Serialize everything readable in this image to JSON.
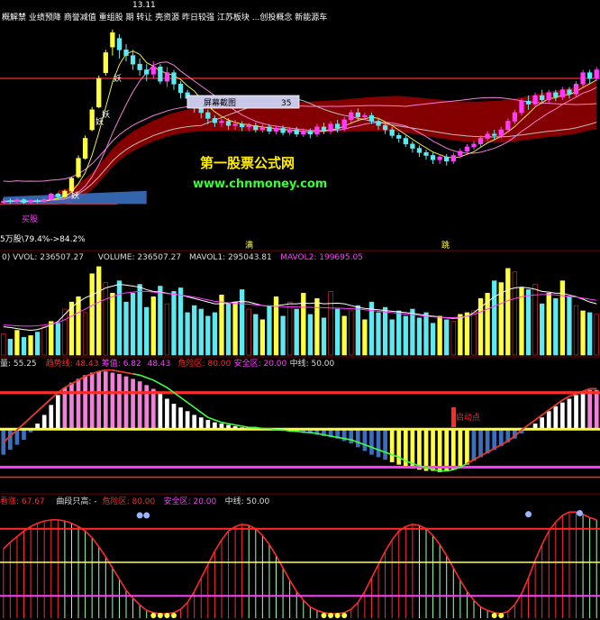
{
  "colors": {
    "bg": "#000000",
    "separator": "#7a0000",
    "red": "#ff2a2a",
    "cyan": "#5ee8f0",
    "magenta": "#ff3cff",
    "yellow": "#ffff40",
    "white": "#ffffff",
    "blue": "#3a6fbf",
    "pink": "#f080d8",
    "green": "#40ff40",
    "gray": "#bdbdbd",
    "darkred": "#8b0000",
    "watermark_yellow": "#ffee00",
    "watermark_green": "#33ff33"
  },
  "price_panel": {
    "top_labels": "概解禁 业绩预降 商誉减值 重组股 期 转让 壳资源 昨日较强 江苏板块 ...创投概念 新能源车",
    "high_price": "13.11",
    "demon_marks": [
      "妖",
      "妖",
      "妖",
      "妖"
    ],
    "buy_text": "买股",
    "bottom_left": "5万股\\79.4%->84.2%",
    "marker_full": "满",
    "marker_jump": "跳",
    "screenshot_tooltip": {
      "label": "屏幕截图",
      "value": "35"
    },
    "watermark_title": "第一股票公式网",
    "watermark_url": "www.chnmoney.com"
  },
  "volume_panel": {
    "legend": [
      {
        "text": "0) VVOL: 236507.27",
        "color": "#dddddd"
      },
      {
        "text": "VOLUME: 236507.27",
        "color": "#dddddd"
      },
      {
        "text": "MAVOL1: 295043.81",
        "color": "#dddddd"
      },
      {
        "text": "MAVOL2: 199695.05",
        "color": "#ff3cff"
      }
    ]
  },
  "indicator1": {
    "legend": [
      {
        "text": "量: 55.25",
        "color": "#dddddd"
      },
      {
        "text": "趋势线: 48.43",
        "color": "#ff2a2a"
      },
      {
        "text": "筹值: 6.82",
        "color": "#ff3cff"
      },
      {
        "text": "48.43",
        "color": "#ff3cff"
      },
      {
        "text": "危险区: 80.00",
        "color": "#ff2a2a"
      },
      {
        "text": "安全区: 20.00",
        "color": "#ff3cff"
      },
      {
        "text": "中线: 50.00",
        "color": "#dddddd"
      }
    ],
    "start_label": "启动点"
  },
  "indicator2": {
    "legend": [
      {
        "text": "看涨: 67.67",
        "color": "#ff2a2a"
      },
      {
        "text": "曲段只高: -",
        "color": "#dddddd"
      },
      {
        "text": "危险区: 80.00",
        "color": "#ff2a2a"
      },
      {
        "text": "安全区: 20.00",
        "color": "#ff3cff"
      },
      {
        "text": "中线: 50.00",
        "color": "#dddddd"
      }
    ]
  },
  "chart_data": [
    {
      "type": "candlestick",
      "title": "",
      "ylim": [
        6.0,
        13.2
      ],
      "y_labeled": {
        "high": 13.11
      },
      "candles": [
        [
          7.05,
          7.1,
          7.0,
          7.2
        ],
        [
          7.12,
          7.08,
          7.0,
          7.2
        ],
        [
          7.08,
          7.15,
          7.02,
          7.22
        ],
        [
          7.15,
          7.05,
          7.0,
          7.2
        ],
        [
          7.06,
          7.12,
          7.0,
          7.18
        ],
        [
          7.12,
          7.08,
          7.02,
          7.18
        ],
        [
          7.08,
          7.16,
          7.04,
          7.22
        ],
        [
          7.16,
          7.35,
          7.12,
          7.4
        ],
        [
          7.35,
          7.25,
          7.2,
          7.4
        ],
        [
          7.25,
          7.45,
          7.22,
          7.5
        ],
        [
          7.45,
          7.9,
          7.4,
          7.95
        ],
        [
          7.95,
          8.6,
          7.9,
          8.7
        ],
        [
          8.6,
          9.3,
          8.55,
          9.4
        ],
        [
          9.6,
          10.3,
          9.55,
          10.4
        ],
        [
          10.4,
          11.4,
          10.35,
          11.5
        ],
        [
          11.6,
          12.3,
          11.5,
          12.4
        ],
        [
          12.5,
          13.0,
          12.2,
          13.11
        ],
        [
          12.8,
          12.4,
          12.1,
          12.95
        ],
        [
          12.4,
          12.2,
          12.0,
          12.6
        ],
        [
          12.2,
          11.9,
          11.7,
          12.4
        ],
        [
          11.9,
          11.7,
          11.5,
          12.1
        ],
        [
          11.7,
          11.55,
          11.3,
          11.9
        ],
        [
          11.55,
          11.8,
          11.4,
          12.0
        ],
        [
          11.8,
          11.3,
          11.2,
          11.9
        ],
        [
          11.3,
          11.6,
          11.1,
          11.8
        ],
        [
          11.6,
          11.2,
          11.0,
          11.7
        ],
        [
          11.2,
          10.9,
          10.7,
          11.3
        ],
        [
          10.9,
          10.7,
          10.4,
          11.0
        ],
        [
          10.7,
          10.4,
          10.2,
          10.8
        ],
        [
          10.4,
          10.2,
          10.0,
          10.5
        ],
        [
          10.2,
          10.0,
          9.8,
          10.3
        ],
        [
          10.0,
          9.85,
          9.7,
          10.1
        ],
        [
          9.85,
          9.9,
          9.7,
          10.0
        ],
        [
          9.9,
          9.75,
          9.6,
          10.0
        ],
        [
          9.75,
          9.8,
          9.6,
          9.95
        ],
        [
          9.8,
          9.7,
          9.55,
          9.9
        ],
        [
          9.7,
          9.75,
          9.55,
          9.85
        ],
        [
          9.75,
          9.6,
          9.5,
          9.85
        ],
        [
          9.6,
          9.7,
          9.5,
          9.8
        ],
        [
          9.7,
          9.55,
          9.45,
          9.8
        ],
        [
          9.55,
          9.65,
          9.45,
          9.75
        ],
        [
          9.65,
          9.5,
          9.4,
          9.75
        ],
        [
          9.5,
          9.6,
          9.4,
          9.7
        ],
        [
          9.6,
          9.45,
          9.35,
          9.7
        ],
        [
          9.45,
          9.55,
          9.35,
          9.65
        ],
        [
          9.55,
          9.45,
          9.3,
          9.65
        ],
        [
          9.45,
          9.7,
          9.35,
          9.8
        ],
        [
          9.7,
          9.55,
          9.45,
          9.85
        ],
        [
          9.55,
          9.8,
          9.45,
          9.9
        ],
        [
          9.8,
          9.65,
          9.5,
          9.95
        ],
        [
          9.65,
          9.95,
          9.55,
          10.05
        ],
        [
          9.95,
          10.2,
          9.85,
          10.3
        ],
        [
          10.2,
          10.05,
          9.9,
          10.35
        ],
        [
          10.05,
          10.1,
          9.95,
          10.2
        ],
        [
          10.1,
          9.9,
          9.8,
          10.2
        ],
        [
          9.9,
          9.75,
          9.6,
          10.0
        ],
        [
          9.75,
          9.6,
          9.45,
          9.85
        ],
        [
          9.6,
          9.4,
          9.3,
          9.7
        ],
        [
          9.4,
          9.3,
          9.15,
          9.5
        ],
        [
          9.3,
          9.1,
          9.0,
          9.4
        ],
        [
          9.1,
          8.95,
          8.8,
          9.2
        ],
        [
          8.95,
          8.8,
          8.65,
          9.05
        ],
        [
          8.8,
          8.7,
          8.55,
          8.9
        ],
        [
          8.7,
          8.55,
          8.4,
          8.8
        ],
        [
          8.55,
          8.65,
          8.4,
          8.75
        ],
        [
          8.65,
          8.5,
          8.35,
          8.75
        ],
        [
          8.5,
          8.7,
          8.4,
          8.8
        ],
        [
          8.7,
          8.85,
          8.6,
          8.95
        ],
        [
          8.85,
          9.0,
          8.75,
          9.1
        ],
        [
          9.0,
          9.1,
          8.9,
          9.2
        ],
        [
          9.1,
          9.3,
          9.0,
          9.4
        ],
        [
          9.3,
          9.45,
          9.2,
          9.55
        ],
        [
          9.45,
          9.4,
          9.25,
          9.6
        ],
        [
          9.4,
          9.6,
          9.3,
          9.7
        ],
        [
          9.6,
          9.9,
          9.5,
          10.0
        ],
        [
          9.9,
          10.2,
          9.8,
          10.3
        ],
        [
          10.2,
          10.6,
          10.1,
          10.7
        ],
        [
          10.6,
          10.5,
          10.3,
          10.8
        ],
        [
          10.5,
          10.8,
          10.4,
          10.9
        ],
        [
          10.8,
          10.65,
          10.5,
          11.0
        ],
        [
          10.65,
          10.9,
          10.55,
          11.0
        ],
        [
          10.9,
          10.75,
          10.6,
          11.0
        ],
        [
          10.75,
          11.0,
          10.65,
          11.1
        ],
        [
          11.0,
          10.85,
          10.7,
          11.1
        ],
        [
          10.85,
          11.2,
          10.75,
          11.3
        ],
        [
          11.2,
          11.6,
          11.1,
          11.7
        ],
        [
          11.6,
          11.4,
          11.2,
          11.7
        ],
        [
          11.4,
          11.7,
          11.3,
          11.8
        ]
      ]
    },
    {
      "type": "bar",
      "title": "VOLUME",
      "volumes": [
        60,
        45,
        70,
        50,
        55,
        65,
        80,
        95,
        90,
        130,
        150,
        165,
        120,
        230,
        250,
        205,
        175,
        210,
        150,
        175,
        200,
        135,
        165,
        195,
        145,
        180,
        190,
        120,
        140,
        130,
        110,
        120,
        170,
        145,
        150,
        185,
        130,
        115,
        100,
        140,
        165,
        110,
        150,
        130,
        175,
        115,
        160,
        105,
        180,
        130,
        110,
        125,
        140,
        100,
        150,
        120,
        135,
        100,
        125,
        110,
        130,
        105,
        120,
        90,
        110,
        100,
        95,
        115,
        120,
        125,
        160,
        175,
        210,
        205,
        245,
        235,
        190,
        185,
        200,
        145,
        175,
        160,
        210,
        165,
        140,
        125,
        120,
        115
      ],
      "mavol1": [
        80,
        78,
        75,
        72,
        70,
        72,
        78,
        85,
        95,
        115,
        135,
        150,
        162,
        170,
        180,
        190,
        195,
        200,
        198,
        195,
        192,
        185,
        180,
        178,
        175,
        172,
        170,
        165,
        160,
        155,
        150,
        145,
        145,
        147,
        150,
        152,
        150,
        145,
        140,
        138,
        140,
        142,
        145,
        145,
        147,
        146,
        148,
        145,
        146,
        147,
        145,
        140,
        135,
        132,
        130,
        128,
        126,
        124,
        122,
        120,
        118,
        115,
        112,
        110,
        108,
        105,
        104,
        105,
        110,
        120,
        135,
        150,
        165,
        175,
        185,
        190,
        192,
        190,
        186,
        180,
        178,
        175,
        175,
        170,
        165,
        158,
        150,
        145
      ],
      "mavol2": [
        85,
        84,
        83,
        82,
        82,
        83,
        85,
        88,
        92,
        100,
        110,
        120,
        130,
        140,
        150,
        158,
        165,
        172,
        176,
        178,
        180,
        180,
        178,
        176,
        174,
        172,
        170,
        167,
        164,
        160,
        156,
        152,
        150,
        148,
        146,
        145,
        144,
        142,
        140,
        139,
        138,
        137,
        136,
        136,
        135,
        135,
        134,
        134,
        133,
        133,
        132,
        131,
        130,
        128,
        126,
        124,
        122,
        120,
        118,
        116,
        114,
        112,
        110,
        108,
        107,
        106,
        106,
        107,
        110,
        115,
        122,
        130,
        138,
        146,
        154,
        160,
        165,
        168,
        170,
        171,
        171,
        170,
        168,
        166,
        164,
        161,
        158,
        155
      ]
    },
    {
      "type": "bar",
      "title": "indicator1",
      "ylim": [
        0,
        100
      ],
      "danger": 80,
      "safety": 20,
      "mid": 50,
      "trend": [
        40,
        45,
        50,
        55,
        60,
        65,
        70,
        75,
        80,
        84,
        87,
        90,
        93,
        95,
        97,
        98,
        98,
        97,
        96,
        95,
        94,
        92,
        90,
        87,
        84,
        80,
        76,
        72,
        68,
        64,
        60,
        58,
        56,
        55,
        54,
        53,
        52,
        52,
        51,
        51,
        50,
        50,
        49,
        49,
        48,
        48,
        47,
        46,
        45,
        44,
        43,
        42,
        40,
        38,
        36,
        34,
        32,
        30,
        28,
        25,
        23,
        21,
        20,
        18,
        17,
        17,
        18,
        20,
        23,
        26,
        29,
        32,
        35,
        38,
        41,
        45,
        50,
        54,
        58,
        62,
        66,
        70,
        74,
        77,
        79,
        81,
        83,
        83
      ],
      "guard": [
        30,
        34,
        38,
        42,
        48,
        55,
        62,
        70,
        78,
        84,
        88,
        91,
        94,
        96,
        97,
        97,
        96,
        95,
        93,
        91,
        89,
        86,
        83,
        79,
        75,
        71,
        68,
        65,
        62,
        60,
        58,
        56,
        55,
        54,
        53,
        52,
        52,
        51,
        51,
        50,
        50,
        49,
        49,
        48,
        48,
        47,
        46,
        45,
        44,
        43,
        41,
        39,
        36,
        33,
        30,
        28,
        26,
        24,
        22,
        20,
        19,
        18,
        17,
        17,
        16,
        17,
        18,
        20,
        22,
        25,
        28,
        31,
        34,
        37,
        40,
        43,
        47,
        51,
        55,
        60,
        65,
        69,
        72,
        75,
        78,
        80,
        82,
        82
      ]
    },
    {
      "type": "bar",
      "title": "indicator2",
      "ylim": [
        0,
        100
      ],
      "danger": 80,
      "safety": 20,
      "mid": 50,
      "values": [
        62,
        68,
        73,
        78,
        82,
        85,
        87,
        88,
        88,
        87,
        85,
        82,
        78,
        72,
        64,
        55,
        45,
        35,
        25,
        18,
        12,
        7,
        5,
        4,
        4,
        5,
        8,
        14,
        24,
        36,
        48,
        60,
        70,
        78,
        82,
        84,
        83,
        80,
        74,
        66,
        56,
        45,
        34,
        24,
        16,
        10,
        7,
        5,
        4,
        4,
        5,
        8,
        14,
        24,
        36,
        48,
        60,
        70,
        78,
        82,
        84,
        83,
        80,
        74,
        66,
        56,
        45,
        34,
        24,
        16,
        10,
        7,
        5,
        4,
        6,
        12,
        22,
        36,
        52,
        66,
        78,
        86,
        92,
        95,
        95,
        93,
        90,
        88
      ]
    }
  ]
}
